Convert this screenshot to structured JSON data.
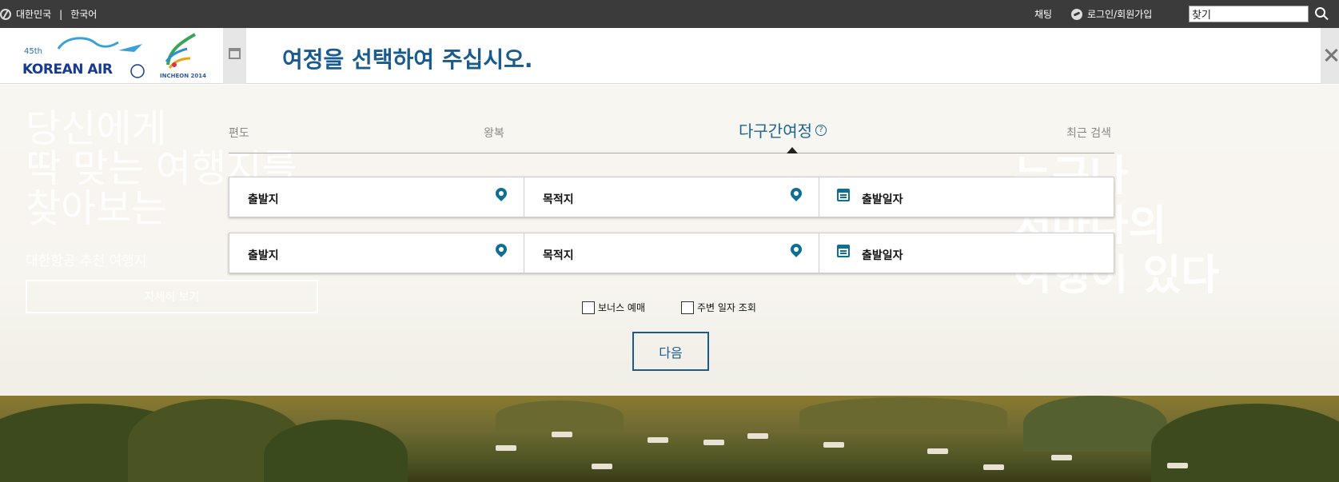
{
  "topbar": {
    "country": "대한민국",
    "separator": "|",
    "language": "한국어",
    "chat": "채팅",
    "login": "로그인/회원가입",
    "search_value": "찾기"
  },
  "header": {
    "brand": "KOREAN AIR",
    "anniversary": "45th",
    "event_logo": "INCHEON 2014",
    "title": "여정을 선택하여 주십시오."
  },
  "background": {
    "headline": [
      "당신에게",
      "딱 맞는 여행지를",
      "찾아보는"
    ],
    "subline": "대한항공 추천 여행지",
    "button": "자세히 보기",
    "slogan": [
      "누구나",
      "저마다의",
      "여행이 있다"
    ]
  },
  "trip_tabs": [
    {
      "label": "편도",
      "active": false
    },
    {
      "label": "왕복",
      "active": false
    },
    {
      "label": "다구간여정",
      "active": true,
      "help_icon": "?"
    },
    {
      "label": "최근 검색",
      "active": false
    }
  ],
  "segments": [
    {
      "origin": "출발지",
      "destination": "목적지",
      "date": "출발일자"
    },
    {
      "origin": "출발지",
      "destination": "목적지",
      "date": "출발일자"
    }
  ],
  "options": {
    "bonus": "보너스 예매",
    "nearby_dates": "주변 일자 조회"
  },
  "next_button": "다음",
  "colors": {
    "topbar": "#3b3b3b",
    "accent": "#1a5b8e",
    "icon": "#0e6f95"
  }
}
